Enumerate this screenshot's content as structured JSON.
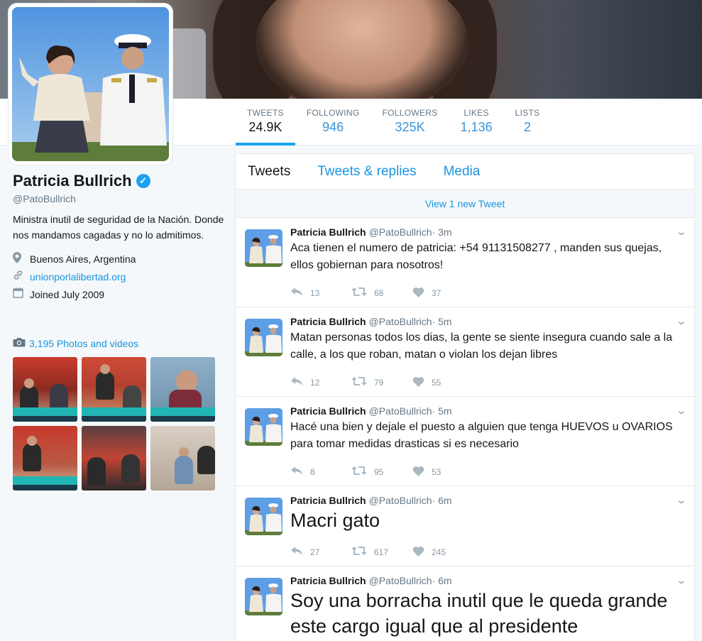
{
  "profile": {
    "name": "Patricia Bullrich",
    "handle": "@PatoBullrich",
    "bio": "Ministra inutil de seguridad de la Nación. Donde nos mandamos cagadas y no lo admitimos.",
    "location": "Buenos Aires, Argentina",
    "website": "unionporlalibertad.org",
    "joined": "Joined July 2009",
    "photos_link": "3,195 Photos and videos",
    "verified_icon": "verified-badge-icon"
  },
  "nav": [
    {
      "label": "TWEETS",
      "value": "24.9K"
    },
    {
      "label": "FOLLOWING",
      "value": "946"
    },
    {
      "label": "FOLLOWERS",
      "value": "325K"
    },
    {
      "label": "LIKES",
      "value": "1,136"
    },
    {
      "label": "LISTS",
      "value": "2"
    }
  ],
  "tabs": [
    "Tweets",
    "Tweets & replies",
    "Media"
  ],
  "new_tweet_bar": "View 1 new Tweet",
  "tweets": [
    {
      "name": "Patricia Bullrich",
      "handle": "@PatoBullrich",
      "time": " · 3m",
      "text": "Aca tienen el numero de patricia: +54 91131508277 , manden sus quejas, ellos gobiernan para nosotros!",
      "replies": "13",
      "retweets": "68",
      "likes": "37"
    },
    {
      "name": "Patricia Bullrich",
      "handle": "@PatoBullrich",
      "time": " · 5m",
      "text": "Matan personas todos los dias, la gente se siente insegura cuando sale a la calle, a los que roban, matan o violan los dejan libres",
      "replies": "12",
      "retweets": "79",
      "likes": "55"
    },
    {
      "name": "Patricia Bullrich",
      "handle": "@PatoBullrich",
      "time": " · 5m",
      "text": "Hacé una bien y dejale el puesto a alguien que tenga HUEVOS u OVARIOS para tomar medidas drasticas si es necesario",
      "replies": "8",
      "retweets": "95",
      "likes": "53"
    },
    {
      "name": "Patricia Bullrich",
      "handle": "@PatoBullrich",
      "time": " · 6m",
      "text": "Macri gato",
      "replies": "27",
      "retweets": "617",
      "likes": "245"
    },
    {
      "name": "Patricia Bullrich",
      "handle": "@PatoBullrich",
      "time": " · 6m",
      "text": "Soy una borracha inutil que le queda grande este cargo igual que al presidente",
      "replies": "",
      "retweets": "",
      "likes": ""
    }
  ],
  "colors": {
    "accent": "#1da1f2",
    "link": "#1b95e0",
    "muted": "#657786"
  }
}
